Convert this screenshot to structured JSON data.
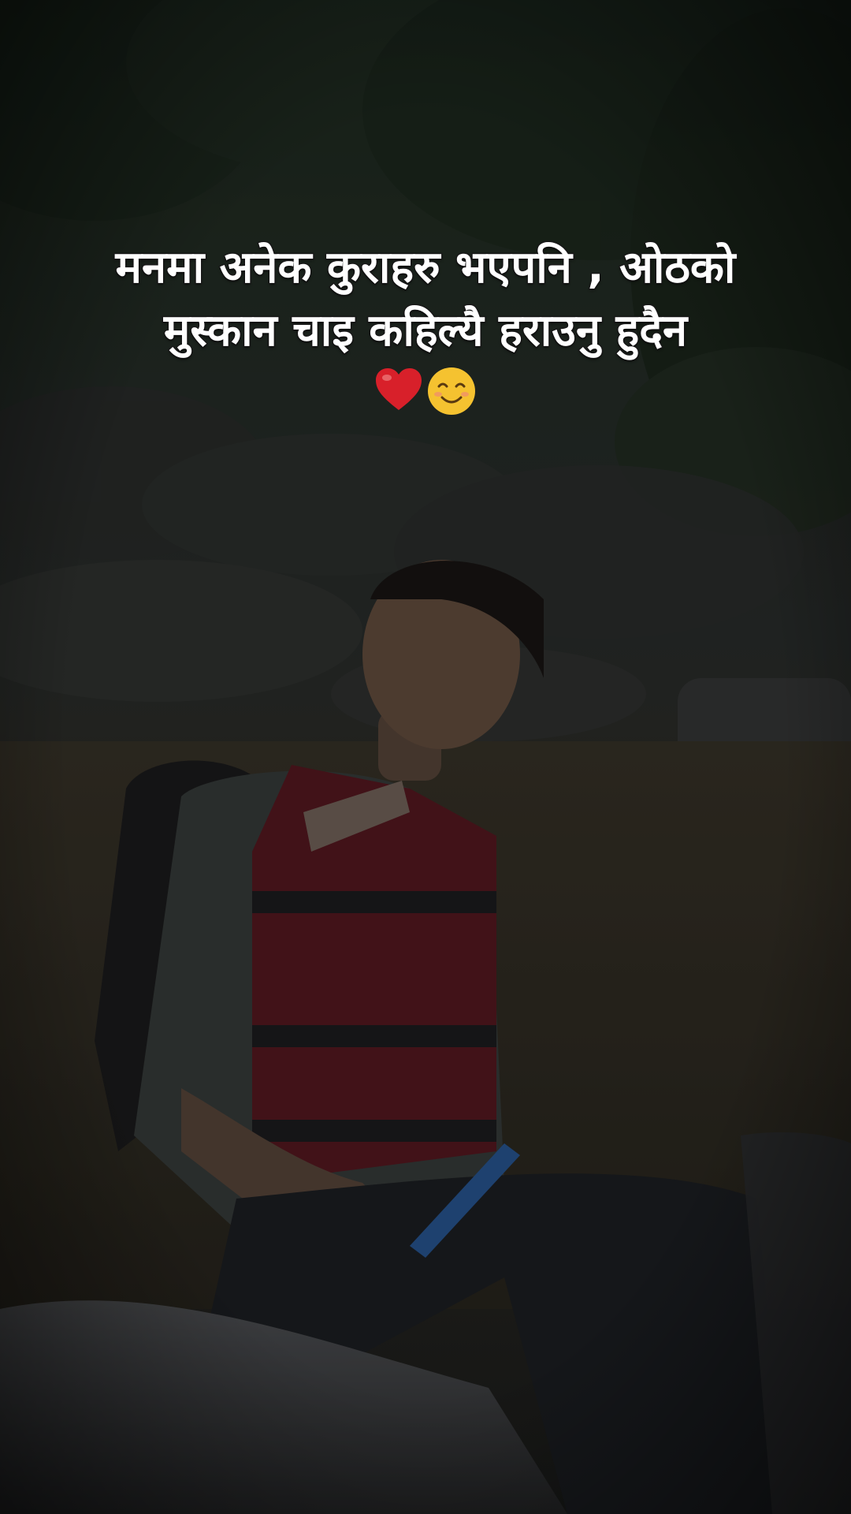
{
  "caption": {
    "line1": "मनमा अनेक कुराहरु भएपनि , ओठको",
    "line2": "मुस्कान चाइ कहिल्यै हराउनु हुदैन"
  },
  "emojis": {
    "first": "heart-emoji",
    "second": "smiling-face-emoji"
  },
  "colors": {
    "caption_text": "#ffffff",
    "caption_outline": "#1a1a1a",
    "life_jacket": "#5a1a22",
    "paddle": "#2a5a9a"
  }
}
